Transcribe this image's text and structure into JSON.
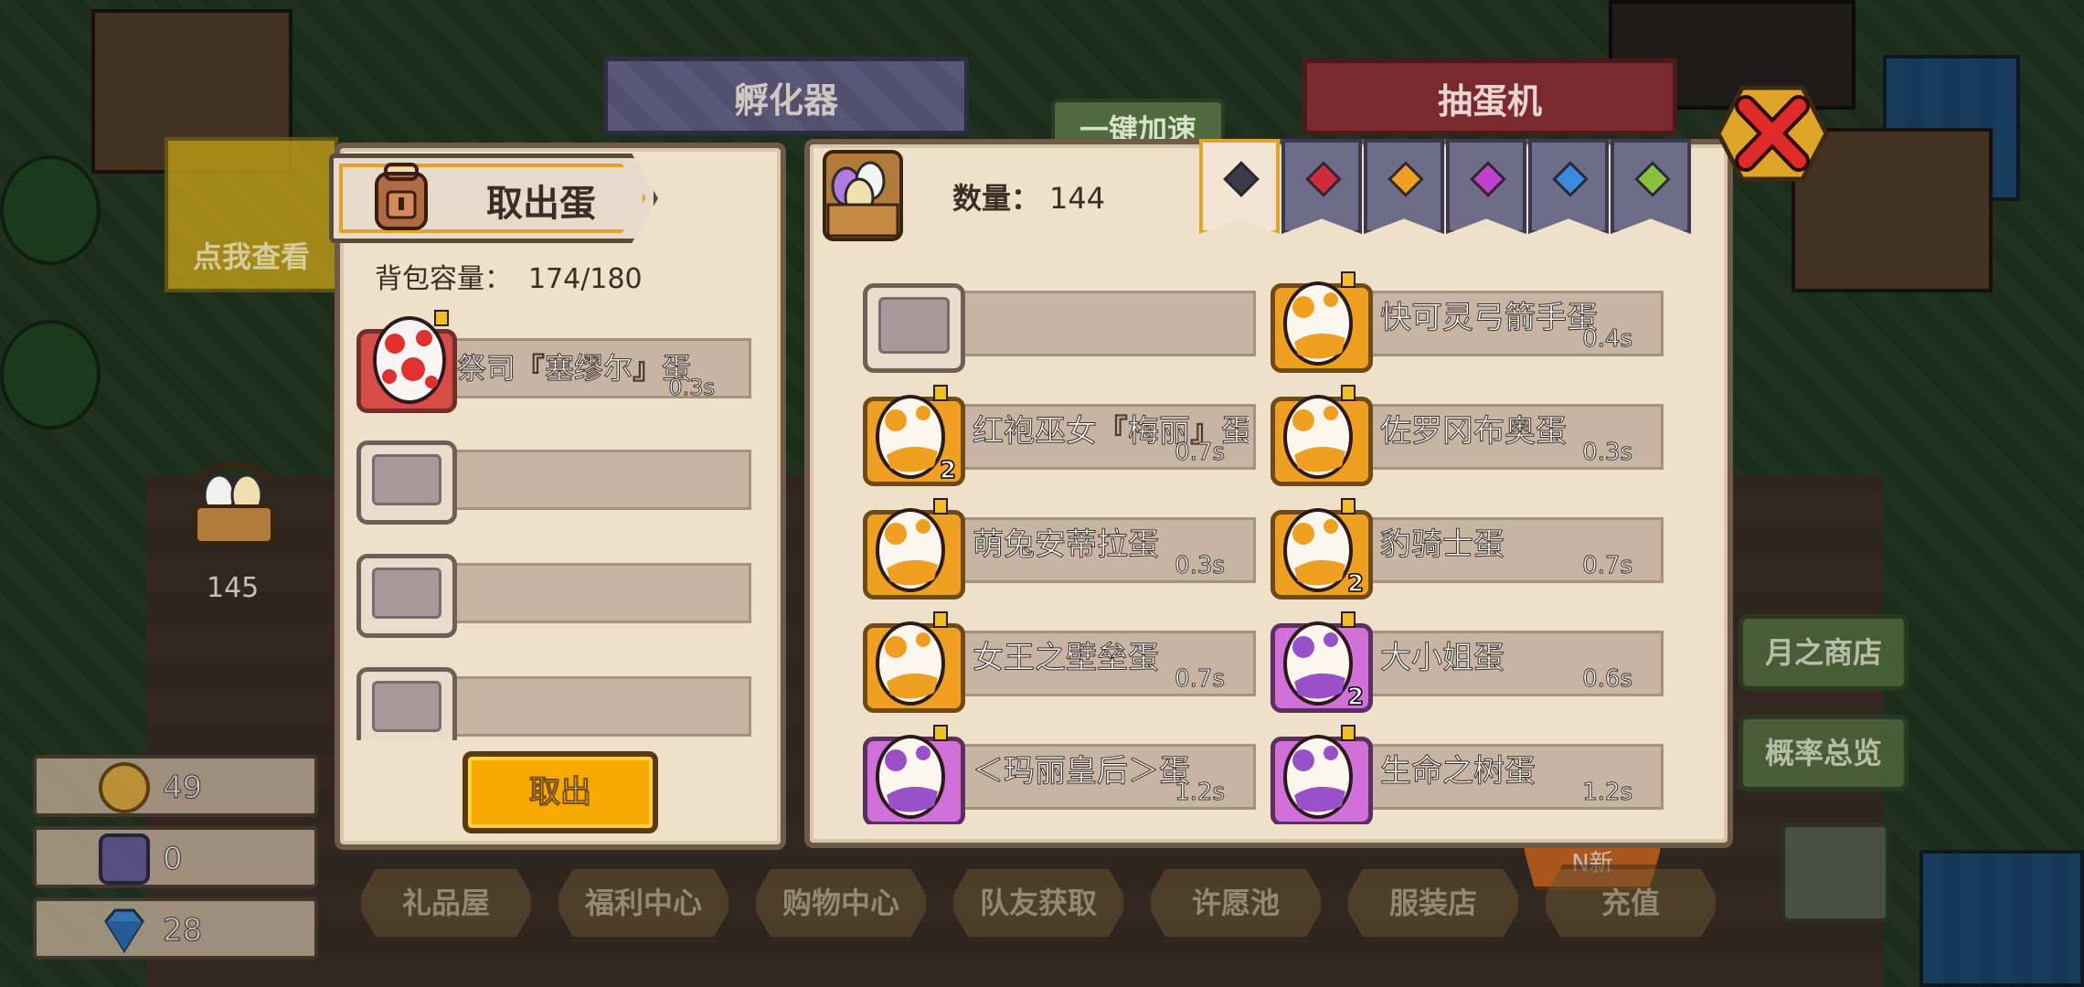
{
  "background": {
    "incubator_sign": "孵化器",
    "gacha_sign": "抽蛋机",
    "quick_speedup": "一键加速",
    "click_to_view": "点我查看",
    "basket_count": "145",
    "right_buttons": [
      "月之商店",
      "概率总览"
    ],
    "bottom_nav": [
      "礼品屋",
      "福利中心",
      "购物中心",
      "队友获取",
      "许愿池",
      "服装店",
      "充值"
    ],
    "new_badge": "N新"
  },
  "currencies": [
    {
      "icon": "potion-coin-icon",
      "value": "49"
    },
    {
      "icon": "character-token-icon",
      "value": "0"
    },
    {
      "icon": "diamond-icon",
      "value": "28"
    }
  ],
  "left_panel": {
    "title": "取出蛋",
    "capacity_label": "背包容量：",
    "capacity_value": "174/180",
    "slots": [
      {
        "name": "祭司『塞缪尔』蛋",
        "time": "0.3s",
        "egg": "red"
      },
      {
        "name": "",
        "time": "",
        "egg": "empty"
      },
      {
        "name": "",
        "time": "",
        "egg": "empty"
      },
      {
        "name": "",
        "time": "",
        "egg": "empty"
      }
    ],
    "take_out_button": "取出"
  },
  "right_panel": {
    "count_label": "数量：",
    "count_value": "144",
    "tabs": [
      {
        "gem_color": "#3a3a48",
        "active": true
      },
      {
        "gem_color": "#d02a3a",
        "active": false
      },
      {
        "gem_color": "#f0a020",
        "active": false
      },
      {
        "gem_color": "#c040d0",
        "active": false
      },
      {
        "gem_color": "#3a8ae0",
        "active": false
      },
      {
        "gem_color": "#8ac040",
        "active": false
      }
    ],
    "eggs": [
      {
        "name": "",
        "time": "",
        "type": "empty",
        "qty": ""
      },
      {
        "name": "快可灵弓箭手蛋",
        "time": "0.4s",
        "type": "orange",
        "qty": ""
      },
      {
        "name": "红袍巫女『梅丽』蛋",
        "time": "0.7s",
        "type": "orange",
        "qty": "2"
      },
      {
        "name": "佐罗冈布奥蛋",
        "time": "0.3s",
        "type": "orange",
        "qty": ""
      },
      {
        "name": "萌兔安蒂拉蛋",
        "time": "0.3s",
        "type": "orange",
        "qty": ""
      },
      {
        "name": "豹骑士蛋",
        "time": "0.7s",
        "type": "orange",
        "qty": "2"
      },
      {
        "name": "女王之壁垒蛋",
        "time": "0.7s",
        "type": "orange",
        "qty": ""
      },
      {
        "name": "大小姐蛋",
        "time": "0.6s",
        "type": "purple",
        "qty": "2"
      },
      {
        "name": "＜玛丽皇后＞蛋",
        "time": "1.2s",
        "type": "purple",
        "qty": ""
      },
      {
        "name": "生命之树蛋",
        "time": "1.2s",
        "type": "purple",
        "qty": ""
      }
    ]
  },
  "colors": {
    "egg_red": "#e03030",
    "egg_orange": "#f0a020",
    "egg_purple": "#9a50c8",
    "button_yellow": "#f6a900"
  }
}
